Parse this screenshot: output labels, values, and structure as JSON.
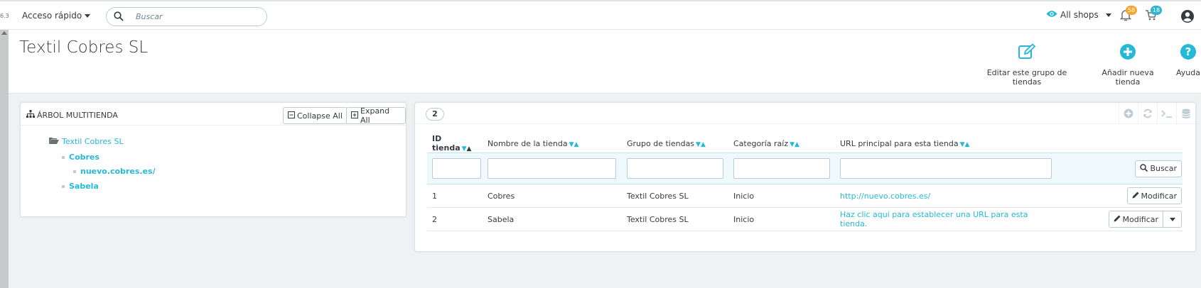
{
  "topbar": {
    "version": "6.3",
    "quick_access": "Acceso rápido",
    "search_placeholder": "Buscar",
    "shop_selector": "All shops",
    "notifications": [
      {
        "icon": "bell-icon",
        "count": "58",
        "color": "#f0a830"
      },
      {
        "icon": "cart-icon",
        "count": "18",
        "color": "#2fb5d2"
      }
    ]
  },
  "header": {
    "title": "Textil Cobres SL",
    "toolbar": {
      "edit_group": "Editar este grupo de tiendas",
      "add_shop": "Añadir nueva tienda",
      "help": "Ayuda"
    }
  },
  "tree": {
    "title": "ÁRBOL MULTITIENDA",
    "collapse_all": "Collapse All",
    "expand_all": "Expand All",
    "root": "Textil Cobres SL",
    "nodes": [
      {
        "label": "Cobres"
      },
      {
        "label": "nuevo.cobres.es/"
      },
      {
        "label": "Sabela"
      }
    ]
  },
  "list": {
    "count": "2",
    "columns": [
      "ID tienda",
      "Nombre de la tienda",
      "Grupo de tiendas",
      "Categoría raíz",
      "URL principal para esta tienda"
    ],
    "search_button": "Buscar",
    "rows": [
      {
        "id": "1",
        "name": "Cobres",
        "group": "Textil Cobres SL",
        "category": "Inicio",
        "url": "http://nuevo.cobres.es/",
        "action": "Modificar"
      },
      {
        "id": "2",
        "name": "Sabela",
        "group": "Textil Cobres SL",
        "category": "Inicio",
        "url": "Haz clic aquí para establecer una URL para esta tienda.",
        "action": "Modificar"
      }
    ]
  },
  "colors": {
    "accent": "#25b9d7",
    "text": "#363a41",
    "background": "#eff1f2"
  }
}
